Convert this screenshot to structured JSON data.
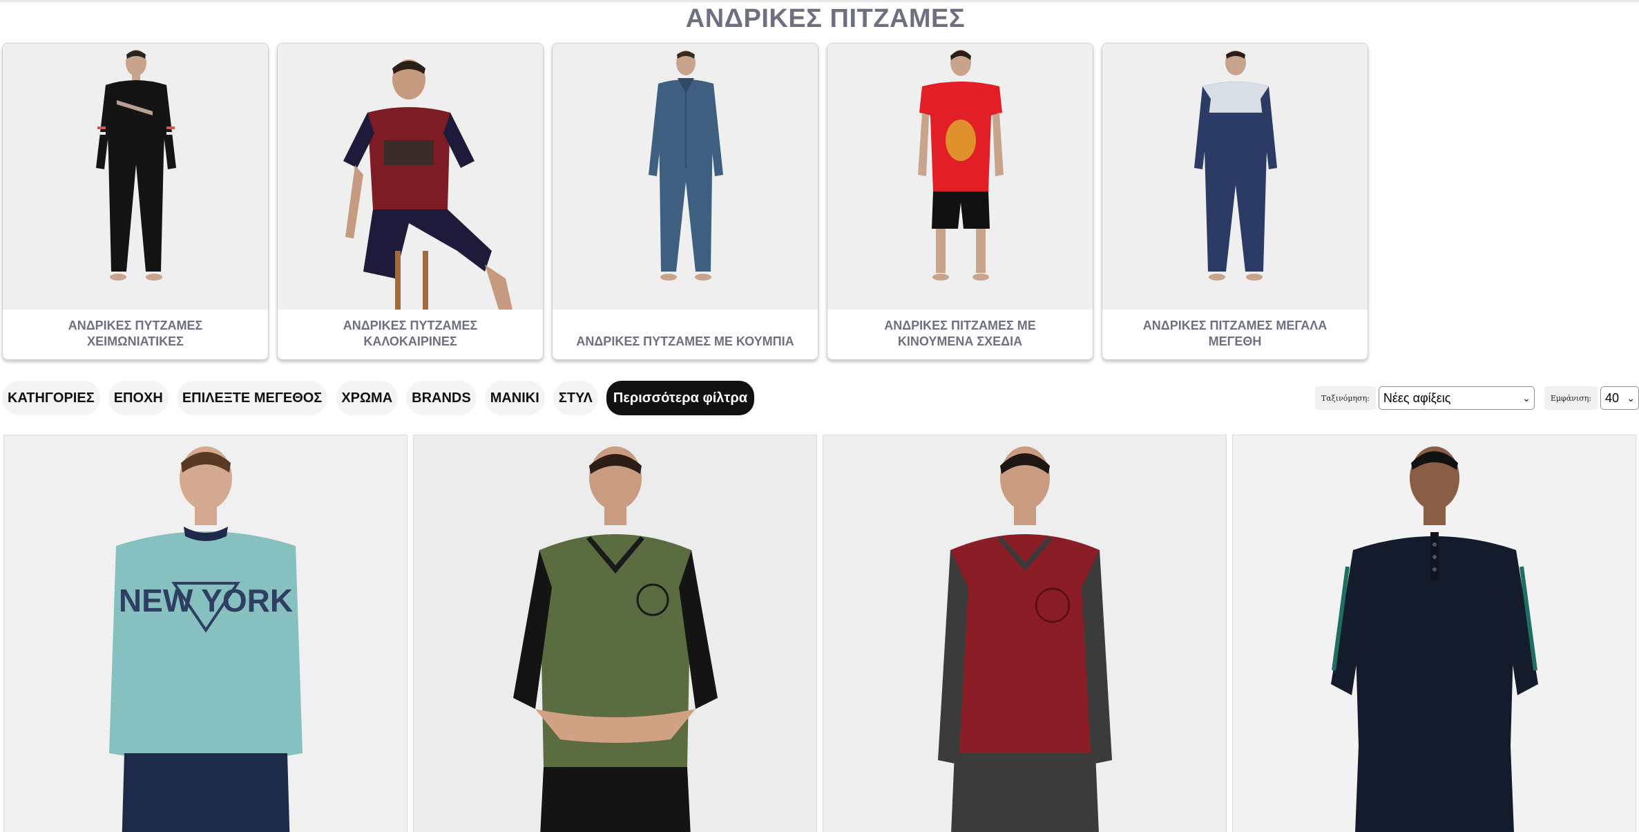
{
  "page": {
    "title": "ΑΝΔΡΙΚΕΣ ΠΙΤΖΑΜΕΣ"
  },
  "subcategories": [
    {
      "label": "ΑΝΔΡΙΚΕΣ ΠΥΤΖΑΜΕΣ ΧΕΙΜΩΝΙΑΤΙΚΕΣ",
      "image": "man in black long-sleeve pyjama"
    },
    {
      "label": "ΑΝΔΡΙΚΕΣ ΠΥΤΖΑΜΕΣ ΚΑΛΟΚΑΙΡΙΝΕΣ",
      "image": "man in burgundy short pyjama sitting"
    },
    {
      "label": "ΑΝΔΡΙΚΕΣ ΠΥΤΖΑΜΕΣ ΜΕ ΚΟΥΜΠΙΑ",
      "image": "man in blue button pyjama"
    },
    {
      "label": "ΑΝΔΡΙΚΕΣ ΠΙΤΖΑΜΕΣ ΜΕ ΚΙΝΟΥΜΕΝΑ ΣΧΕΔΙΑ",
      "image": "man in red cartoon t-shirt"
    },
    {
      "label": "ΑΝΔΡΙΚΕΣ ΠΙΤΖΑΜΕΣ ΜΕΓΑΛΑ ΜΕΓΕΘΗ",
      "image": "man in navy pyjama with grey yoke"
    }
  ],
  "filters": [
    {
      "label": "ΚΑΤΗΓΟΡΙΕΣ"
    },
    {
      "label": "ΕΠΟΧΗ"
    },
    {
      "label": "ΕΠΙΛΕΞΤΕ ΜΕΓΕΘΟΣ"
    },
    {
      "label": "ΧΡΩΜΑ"
    },
    {
      "label": "BRANDS"
    },
    {
      "label": "ΜΑΝΙΚΙ"
    },
    {
      "label": "ΣΤΥΛ"
    },
    {
      "label": "Περισσότερα φίλτρα"
    }
  ],
  "sort": {
    "label": "Ταξινόμηση:",
    "value": "Νέες αφίξεις"
  },
  "per_page": {
    "label": "Εμφάνιση:",
    "value": "40"
  },
  "products": [
    {
      "image": "man in light teal NEW YORK long-sleeve pyjama"
    },
    {
      "image": "man in olive green v-neck pyjama with black sleeves"
    },
    {
      "image": "man in burgundy v-neck pyjama with grey sleeves"
    },
    {
      "image": "man in navy henley pyjama with green stripes"
    }
  ],
  "colors": {
    "title": "#6d7080",
    "chip_bg": "#f4f4f4",
    "chip_dark": "#111111"
  }
}
